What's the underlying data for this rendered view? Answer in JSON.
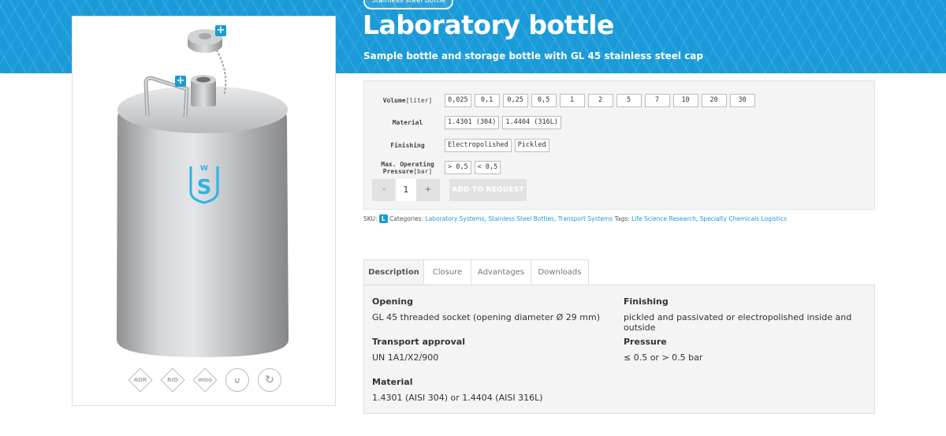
{
  "header": {
    "breadcrumb": "Stainless steel bottle",
    "title": "Laboratory bottle",
    "subtitle": "Sample bottle and storage bottle with GL 45 stainless steel cap"
  },
  "gallery": {
    "zoom_plus": "+",
    "certifications": [
      "ADR",
      "RID",
      "IMDG",
      "UN",
      "recycle"
    ]
  },
  "options": {
    "volume": {
      "label": "Volume",
      "unit": "[liter]",
      "values": [
        "0,025",
        "0,1",
        "0,25",
        "0,5",
        "1",
        "2",
        "5",
        "7",
        "10",
        "20",
        "30"
      ]
    },
    "material": {
      "label": "Material",
      "values": [
        "1.4301 (304)",
        "1.4404 (316L)"
      ]
    },
    "finishing": {
      "label": "Finishing",
      "values": [
        "Electropolished",
        "Pickled"
      ]
    },
    "pressure": {
      "label": "Max. Operating",
      "label2": "Pressure",
      "unit": "[bar]",
      "values": [
        "> 0,5",
        "< 0,5"
      ]
    },
    "quantity": {
      "minus": "-",
      "value": "1",
      "plus": "+"
    },
    "add_to_request": "ADD TO REQUEST"
  },
  "meta": {
    "sku_label": "SKU:",
    "sku_value": "L",
    "categories_label": "Categories:",
    "categories": [
      "Laboratory Systems",
      "Stainless Steel Bottles",
      "Transport Systems"
    ],
    "tags_label": "Tags:",
    "tags": [
      "Life Science Research",
      "Specialty Chemicals Logistics"
    ]
  },
  "tabs": [
    "Description",
    "Closure",
    "Advantages",
    "Downloads"
  ],
  "description": {
    "opening": {
      "heading": "Opening",
      "text": "GL 45 threaded socket (opening diameter Ø 29 mm)"
    },
    "finishing": {
      "heading": "Finishing",
      "text": "pickled and passivated or electropolished inside and outside"
    },
    "transport": {
      "heading": "Transport approval",
      "text": "UN 1A1/X2/900"
    },
    "pressure": {
      "heading": "Pressure",
      "text": "≤ 0.5 or > 0.5 bar"
    },
    "material": {
      "heading": "Material",
      "text": "1.4301 (AISI 304) or 1.4404 (AISI 316L)"
    }
  },
  "colors": {
    "accent": "#1a9ad9",
    "panel": "#f4f4f4",
    "button_disabled": "#e2e2e2"
  }
}
